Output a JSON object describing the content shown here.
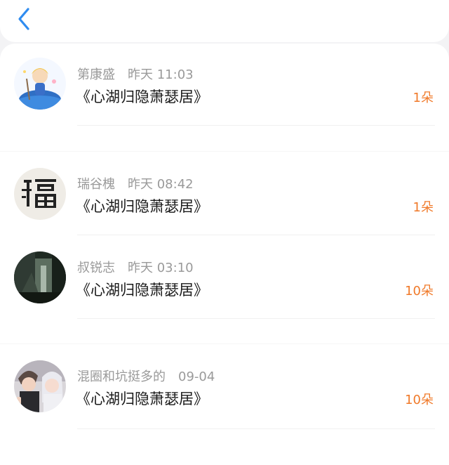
{
  "nav": {
    "back_icon": "chevron-left-icon",
    "accent_color": "#2f8cf0"
  },
  "gift_color": "#f07a2a",
  "records": [
    {
      "name": "第康盛",
      "time": "昨天 11:03",
      "title": "《心湖归隐萧瑟居》",
      "count": "1朵",
      "avatar": "anime-character-avatar"
    },
    {
      "name": "瑞谷槐",
      "time": "昨天 08:42",
      "title": "《心湖归隐萧瑟居》",
      "count": "1朵",
      "avatar": "fu-character-avatar"
    },
    {
      "name": "叔锐志",
      "time": "昨天 03:10",
      "title": "《心湖归隐萧瑟居》",
      "count": "10朵",
      "avatar": "dark-art-avatar"
    },
    {
      "name": "混圈和坑挺多的",
      "time": "09-04",
      "title": "《心湖归隐萧瑟居》",
      "count": "10朵",
      "avatar": "couple-avatar"
    }
  ]
}
